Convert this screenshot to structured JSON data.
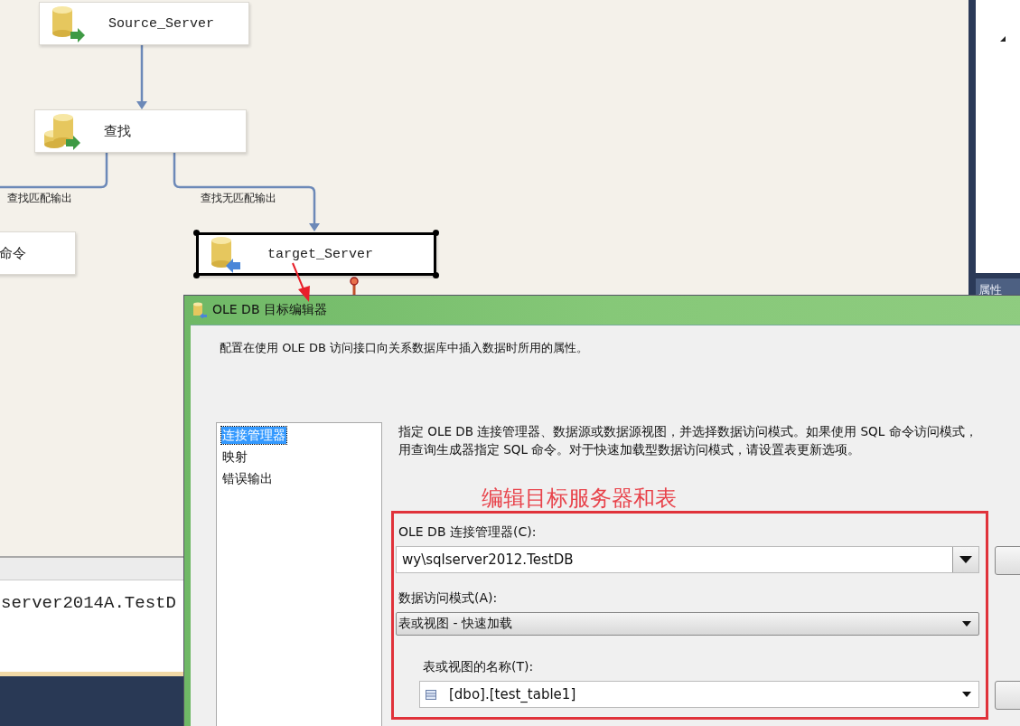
{
  "designer": {
    "nodes": [
      {
        "label": "Source_Server",
        "kind": "source",
        "selected": false
      },
      {
        "label": "查找",
        "kind": "lookup",
        "selected": false
      },
      {
        "label": "命令",
        "kind": "command",
        "selected": false
      },
      {
        "label": "target_Server",
        "kind": "destination",
        "selected": true
      }
    ],
    "path_labels": [
      {
        "label": "查找匹配输出"
      },
      {
        "label": "查找无匹配输出"
      }
    ]
  },
  "properties_panel": {
    "tab": "属性"
  },
  "output_panel": {
    "text": "server2014A.TestD"
  },
  "dialog": {
    "title": "OLE DB 目标编辑器",
    "description": "配置在使用 OLE DB 访问接口向关系数据库中插入数据时所用的属性。",
    "pages": [
      {
        "label": "连接管理器",
        "selected": true
      },
      {
        "label": "映射",
        "selected": false
      },
      {
        "label": "错误输出",
        "selected": false
      }
    ],
    "instructions": [
      "指定 OLE DB 连接管理器、数据源或数据源视图，并选择数据访问模式。如果使用 SQL 命令访问模式，",
      "用查询生成器指定 SQL 命令。对于快速加载型数据访问模式，请设置表更新选项。"
    ],
    "connection_label": "OLE DB 连接管理器(C):",
    "connection_value": "wy\\sqlserver2012.TestDB",
    "mode_label": "数据访问模式(A):",
    "mode_value": "表或视图 - 快速加载",
    "table_label": "表或视图的名称(T):",
    "table_value": "[dbo].[test_table1]"
  },
  "annotation": {
    "text": "编辑目标服务器和表"
  }
}
